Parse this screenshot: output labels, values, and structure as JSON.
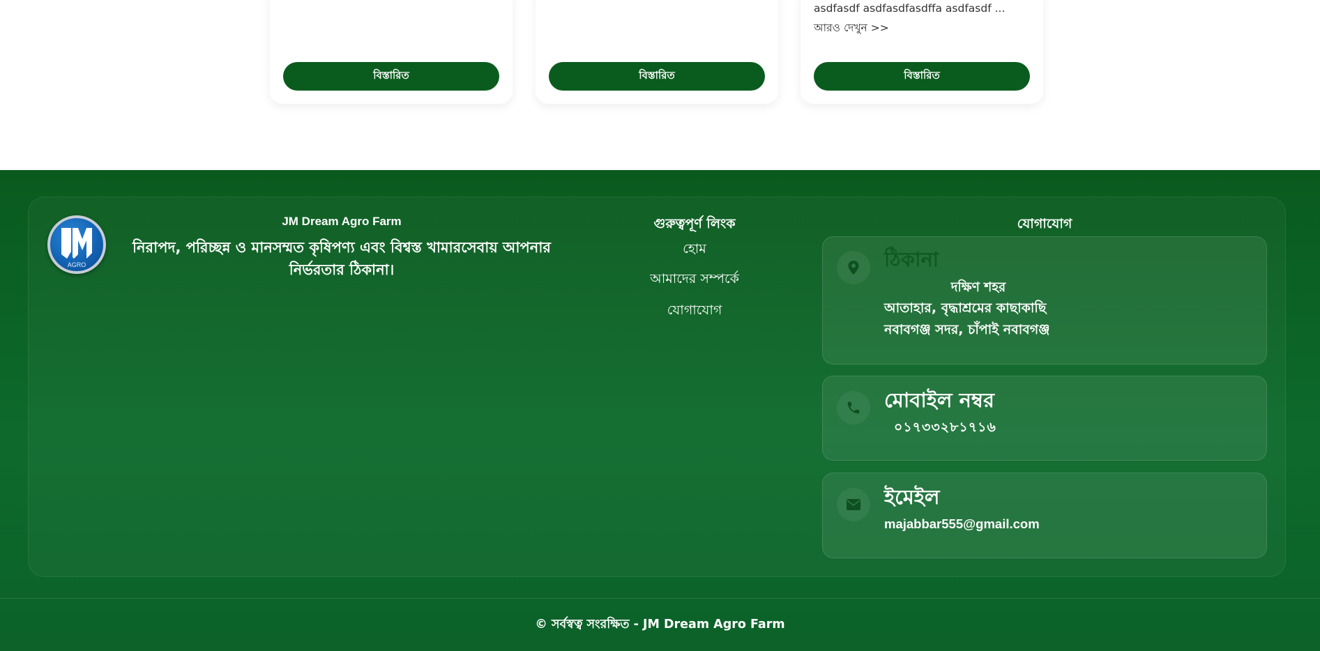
{
  "products": {
    "cards": [
      {
        "excerpt": "",
        "button_label": "বিস্তারিত"
      },
      {
        "excerpt": "",
        "button_label": "বিস্তারিত"
      },
      {
        "excerpt": "asdfasdf asdfasdfasdffa asdfasdf ... আরও দেখুন >>",
        "button_label": "বিস্তারিত"
      }
    ]
  },
  "footer": {
    "logo": {
      "icon": "jm-agro-logo",
      "text_main": "JM",
      "text_sub": "AGRO"
    },
    "brand_title": "JM Dream Agro Farm",
    "tagline": "নিরাপদ, পরিচ্ছন্ন ও মানসম্মত কৃষিপণ্য এবং বিশ্বস্ত খামারসেবায় আপনার নির্ভরতার ঠিকানা।",
    "links": {
      "heading": "গুরুত্বপূর্ণ লিংক",
      "items": [
        "হোম",
        "আমাদের সম্পর্কে",
        "যোগাযোগ"
      ]
    },
    "contact": {
      "heading": "যোগাযোগ",
      "address": {
        "icon": "location-pin-icon",
        "title": "ঠিকানা",
        "line1": "দক্ষিণ শহর",
        "line2": "আতাহার, বৃদ্ধাশ্রমের কাছাকাছি",
        "line3": "নবাবগঞ্জ সদর, চাঁপাই নবাবগঞ্জ"
      },
      "phone": {
        "icon": "phone-icon",
        "title": "মোবাইল নম্বর",
        "value": "০১৭৩৩২৮১৭১৬"
      },
      "email": {
        "icon": "envelope-icon",
        "title": "ইমেইল",
        "value": "majabbar555@gmail.com"
      }
    },
    "copyright": "© সর্বস্বত্ব সংরক্ষিত - JM Dream Agro Farm"
  },
  "colors": {
    "primary_green": "#0a5c1e",
    "footer_bg": "#0b5f22",
    "logo_blue": "#1260b0"
  }
}
